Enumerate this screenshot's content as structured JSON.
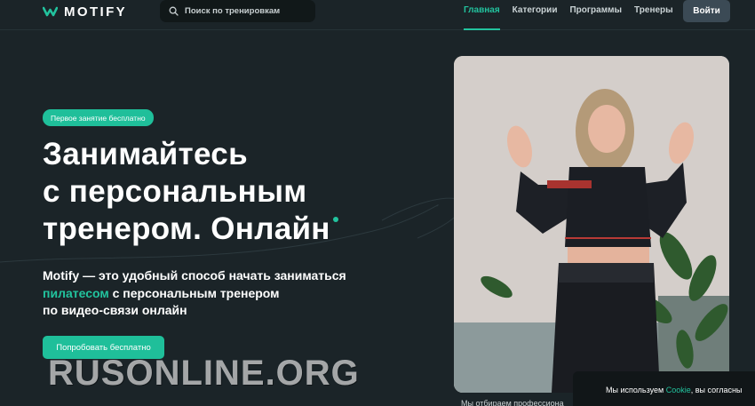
{
  "header": {
    "logo_text": "MOTIFY",
    "search_placeholder": "Поиск по тренировкам",
    "nav": [
      {
        "label": "Главная",
        "active": true
      },
      {
        "label": "Категории",
        "active": false
      },
      {
        "label": "Программы",
        "active": false
      },
      {
        "label": "Тренеры",
        "active": false
      }
    ],
    "login_label": "Войти"
  },
  "hero": {
    "badge": "Первое занятие бесплатно",
    "title_lines": [
      "Занимайтесь",
      "с персональным",
      "тренером. Онлайн"
    ],
    "description_before": "Motify — это удобный способ начать заниматься",
    "description_accent": "пилатесом",
    "description_after_accent": " с персональным тренером",
    "description_end": "по видео-связи онлайн",
    "cta_label": "Попробовать бесплатно"
  },
  "photo_caption": "Мы отбираем профессиона",
  "cookie": {
    "text_before": "Мы используем ",
    "link": "Cookie",
    "text_after": ", вы согласны"
  },
  "watermark": "RUSONLINE.ORG",
  "colors": {
    "background": "#1b2428",
    "accent": "#22c39e",
    "button_dark": "#3b4a55"
  },
  "icons": [
    "logo-mark-icon",
    "search-icon"
  ]
}
